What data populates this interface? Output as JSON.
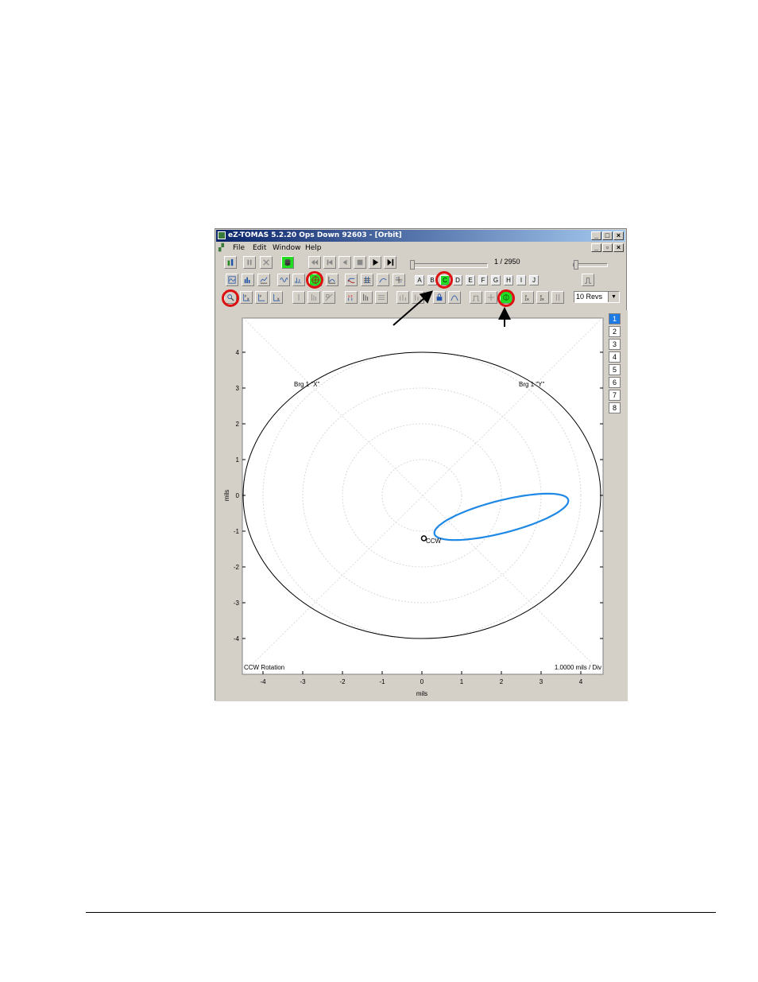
{
  "window": {
    "title": "eZ-TOMAS 5.2.20     Ops Down 92603 - [Orbit]",
    "buttons": {
      "minimize": "_",
      "maximize": "□",
      "close": "×",
      "restore": "▫"
    }
  },
  "menu": {
    "items": [
      "File",
      "Edit",
      "Window",
      "Help"
    ]
  },
  "toolbar1": {
    "frame_counter": "1 / 2950"
  },
  "toolbar2": {
    "letter_buttons": [
      "A",
      "B",
      "C",
      "D",
      "E",
      "F",
      "G",
      "H",
      "I",
      "J"
    ]
  },
  "toolbar3": {
    "revs_select": "10 Revs"
  },
  "channels": [
    "1",
    "2",
    "3",
    "4",
    "5",
    "6",
    "7",
    "8"
  ],
  "active_channel": "1",
  "plot": {
    "probe_x_label": "Brg 1 \"X\"",
    "probe_y_label": "Brg 1 \"Y\"",
    "rotation_marker": "CCW",
    "rotation_text": "CCW Rotation",
    "scale_text": "1.0000 mils / Div",
    "x_axis_label": "mils",
    "y_axis_label": "mils",
    "x_ticks": [
      "-4",
      "-3",
      "-2",
      "-1",
      "0",
      "1",
      "2",
      "3",
      "4"
    ],
    "y_ticks": [
      "4",
      "3",
      "2",
      "1",
      "0",
      "-1",
      "-2",
      "-3",
      "-4"
    ]
  },
  "colors": {
    "orbit": "#1e88e5",
    "highlight": "#dd1111",
    "active_green": "#22dd22"
  }
}
